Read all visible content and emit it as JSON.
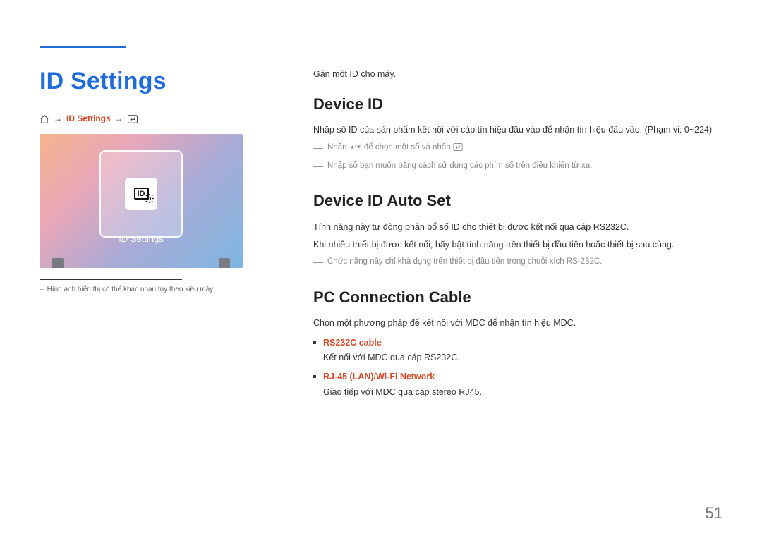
{
  "page_number": "51",
  "left": {
    "title": "ID Settings",
    "breadcrumb_item": "ID Settings",
    "screenshot_caption": "ID Settings",
    "screenshot_icon_text": "ID",
    "note": "Hình ảnh hiển thị có thể khác nhau tùy theo kiểu máy."
  },
  "right": {
    "intro": "Gán một ID cho máy.",
    "section1": {
      "heading": "Device ID",
      "p1": "Nhập số ID của sản phẩm kết nối với cáp tín hiệu đầu vào để nhận tín hiệu đầu vào. (Phạm vi: 0~224)",
      "grey1_pre": "Nhấn ",
      "grey1_post": " để chọn một số và nhấn ",
      "grey2": "Nhập số bạn muốn bằng cách sử dụng các phím số trên điều khiển từ xa."
    },
    "section2": {
      "heading": "Device ID Auto Set",
      "p1": "Tính năng này tự động phân bổ số ID cho thiết bị được kết nối qua cáp RS232C.",
      "p2": "Khi nhiều thiết bị được kết nối, hãy bật tính năng trên thiết bị đầu tiên hoặc thiết bị sau cùng.",
      "grey1": "Chức năng này chỉ khả dụng trên thiết bị đầu tiên trong chuỗi xích RS-232C."
    },
    "section3": {
      "heading": "PC Connection Cable",
      "p1": "Chọn một phương pháp để kết nối với MDC để nhận tín hiệu MDC.",
      "bullets": [
        {
          "label": "RS232C cable",
          "desc": "Kết nối với MDC qua cáp RS232C."
        },
        {
          "label": "RJ-45 (LAN)/Wi-Fi Network",
          "desc": "Giao tiếp với MDC qua cáp stereo RJ45."
        }
      ]
    }
  }
}
